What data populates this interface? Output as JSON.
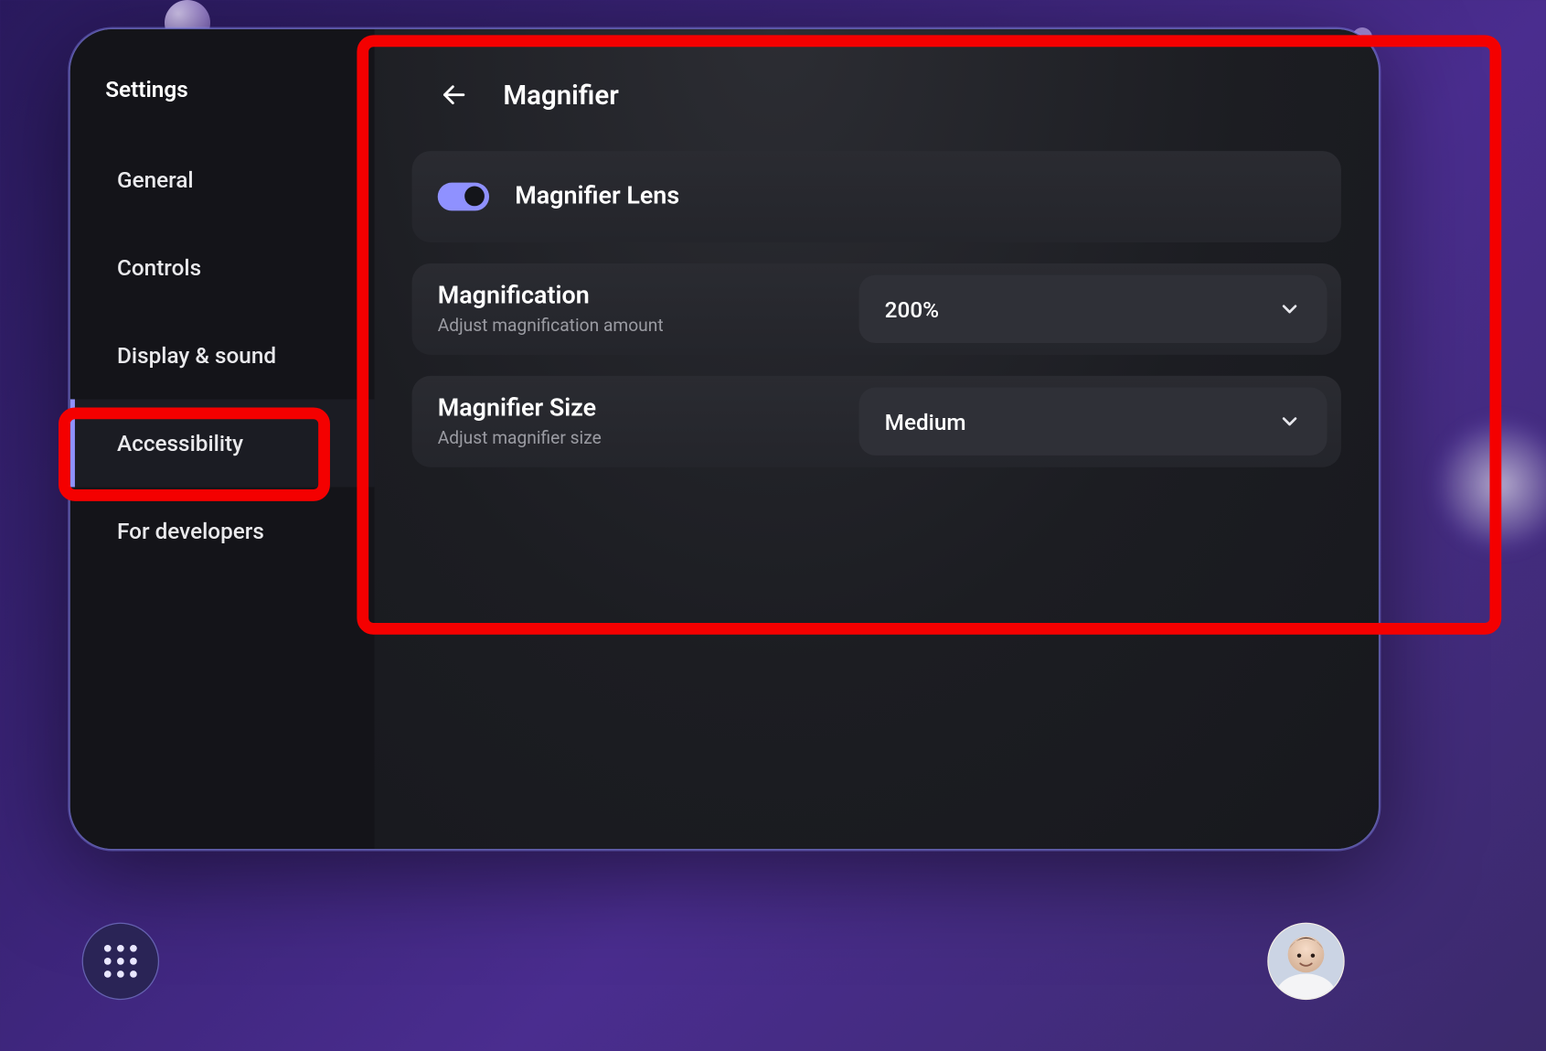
{
  "sidebar": {
    "title": "Settings",
    "items": [
      {
        "label": "General"
      },
      {
        "label": "Controls"
      },
      {
        "label": "Display & sound"
      },
      {
        "label": "Accessibility",
        "active": true
      },
      {
        "label": "For developers"
      }
    ]
  },
  "page": {
    "title": "Magnifier"
  },
  "rows": {
    "lens": {
      "label": "Magnifier Lens",
      "enabled": true
    },
    "magnification": {
      "title": "Magnification",
      "subtitle": "Adjust magnification amount",
      "value": "200%"
    },
    "size": {
      "title": "Magnifier Size",
      "subtitle": "Adjust magnifier size",
      "value": "Medium"
    }
  },
  "highlights": {
    "sidebar_item": "Accessibility",
    "content_panel": true,
    "color": "#f40000"
  },
  "colors": {
    "accent": "#8f91ff",
    "panel": "#14151a",
    "row": "#2a2b31",
    "text": "#ffffff",
    "muted": "#9a9ba2"
  }
}
